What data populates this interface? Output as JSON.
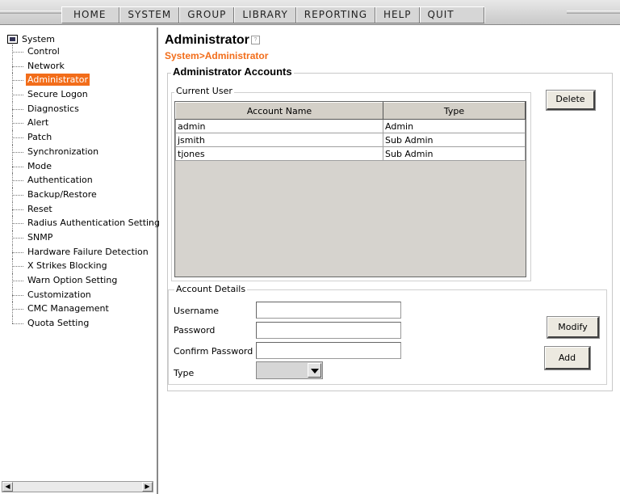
{
  "menu": [
    "HOME",
    "SYSTEM",
    "GROUP",
    "LIBRARY",
    "REPORTING",
    "HELP",
    "QUIT"
  ],
  "tree": {
    "root": "System",
    "items": [
      "Control",
      "Network",
      "Administrator",
      "Secure Logon",
      "Diagnostics",
      "Alert",
      "Patch",
      "Synchronization",
      "Mode",
      "Authentication",
      "Backup/Restore",
      "Reset",
      "Radius Authentication Setting",
      "SNMP",
      "Hardware Failure Detection",
      "X Strikes Blocking",
      "Warn Option Setting",
      "Customization",
      "CMC Management",
      "Quota Setting"
    ],
    "selected": "Administrator"
  },
  "page": {
    "title": "Administrator",
    "help_icon": "?",
    "breadcrumb": "System>Administrator",
    "section_title": "Administrator Accounts"
  },
  "current_user": {
    "label": "Current User",
    "columns": [
      "Account Name",
      "Type"
    ],
    "rows": [
      [
        "admin",
        "Admin"
      ],
      [
        "jsmith",
        "Sub Admin"
      ],
      [
        "tjones",
        "Sub Admin"
      ]
    ],
    "delete_label": "Delete"
  },
  "account_details": {
    "label": "Account Details",
    "username_label": "Username",
    "username_value": "",
    "password_label": "Password",
    "password_value": "",
    "confirm_label": "Confirm Password",
    "confirm_value": "",
    "type_label": "Type",
    "type_value": "",
    "modify_label": "Modify",
    "add_label": "Add"
  },
  "scroll": {
    "left_arrow": "◀",
    "right_arrow": "▶"
  }
}
